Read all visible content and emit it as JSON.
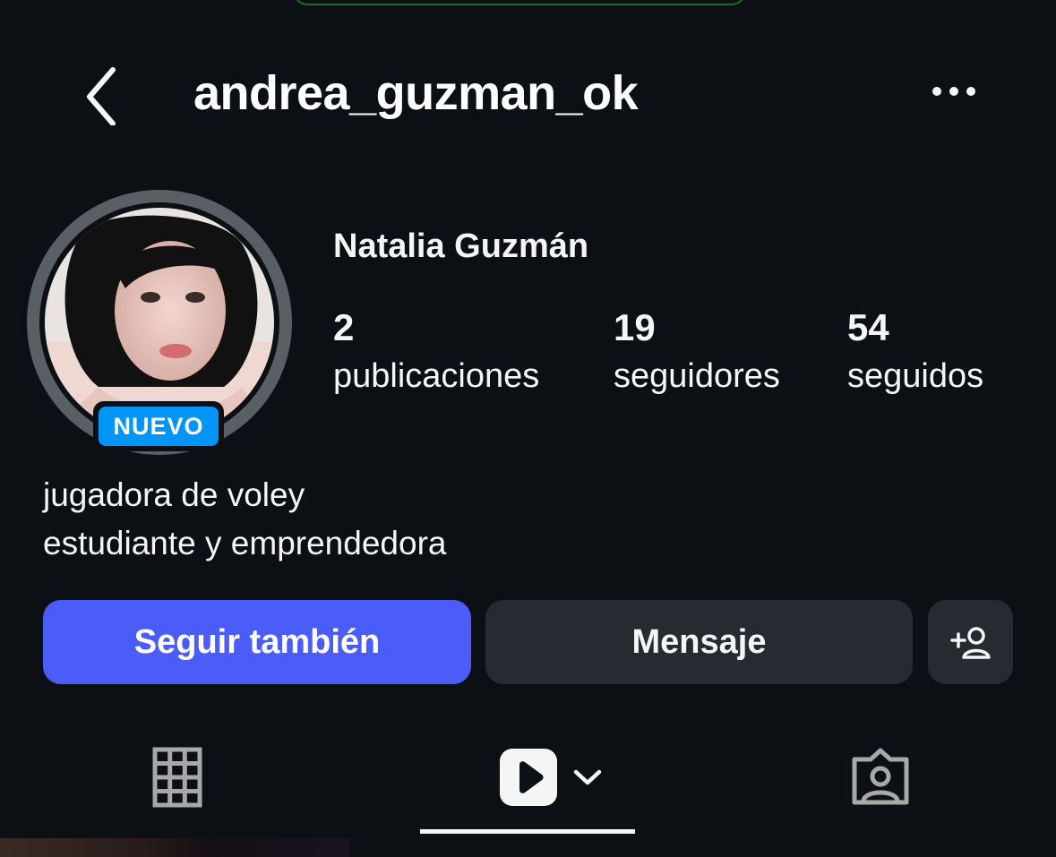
{
  "header": {
    "username": "andrea_guzman_ok",
    "back_icon": "chevron-left-icon",
    "more_icon": "more-horizontal-icon"
  },
  "profile": {
    "display_name": "Natalia Guzmán",
    "badge": "NUEVO",
    "stats": [
      {
        "value": "2",
        "label": "publicaciones"
      },
      {
        "value": "19",
        "label": "seguidores"
      },
      {
        "value": "54",
        "label": "seguidos"
      }
    ],
    "bio": [
      "jugadora de voley",
      "estudiante y emprendedora"
    ]
  },
  "actions": {
    "follow_label": "Seguir también",
    "message_label": "Mensaje",
    "add_user_icon": "add-user-icon"
  },
  "tabs": [
    {
      "icon": "grid-icon",
      "selected": false
    },
    {
      "icon": "reels-icon",
      "selected": true
    },
    {
      "icon": "tagged-icon",
      "selected": false
    }
  ],
  "colors": {
    "background": "#0c1014",
    "follow_button": "#4a5df9",
    "secondary_button": "#262a31",
    "badge": "#0095f6"
  }
}
